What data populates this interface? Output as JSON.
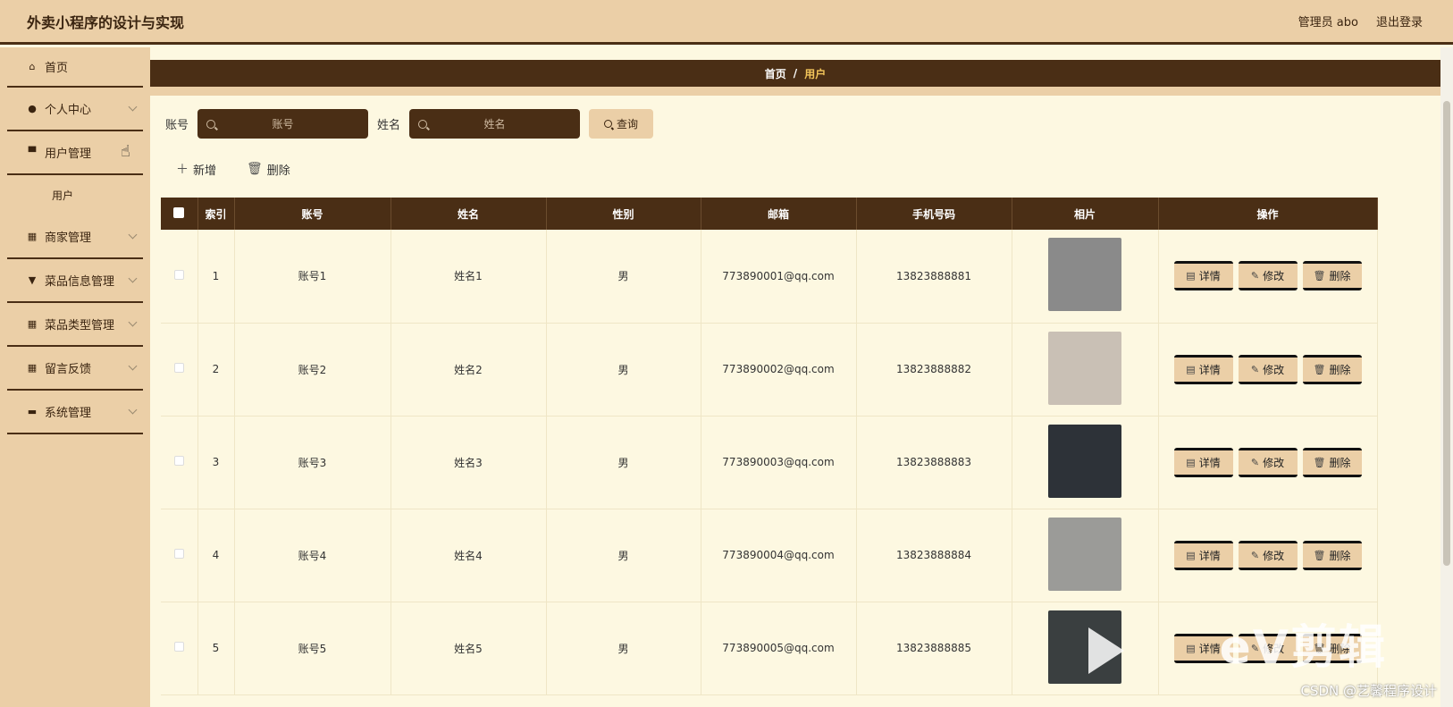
{
  "header": {
    "title": "外卖小程序的设计与实现",
    "user_label": "管理员 abo",
    "logout": "退出登录"
  },
  "sidebar": {
    "items": [
      {
        "label": "首页",
        "icon": "home-icon",
        "has_chevron": false
      },
      {
        "label": "个人中心",
        "icon": "user-icon",
        "has_chevron": true
      },
      {
        "label": "用户管理",
        "icon": "folder-icon",
        "has_chevron": true,
        "expanded": true
      },
      {
        "label": "用户",
        "sub": true
      },
      {
        "label": "商家管理",
        "icon": "grid-icon",
        "has_chevron": true
      },
      {
        "label": "菜品信息管理",
        "icon": "flag-icon",
        "has_chevron": true
      },
      {
        "label": "菜品类型管理",
        "icon": "grid-icon",
        "has_chevron": true
      },
      {
        "label": "留言反馈",
        "icon": "grid-icon",
        "has_chevron": true
      },
      {
        "label": "系统管理",
        "icon": "monitor-icon",
        "has_chevron": true
      }
    ]
  },
  "breadcrumb": {
    "home": "首页",
    "separator": "/",
    "current": "用户"
  },
  "search": {
    "account_label": "账号",
    "account_placeholder": "账号",
    "name_label": "姓名",
    "name_placeholder": "姓名",
    "query_button": "查询"
  },
  "toolbar": {
    "add": "新增",
    "delete": "删除"
  },
  "table": {
    "columns": [
      "索引",
      "账号",
      "姓名",
      "性别",
      "邮箱",
      "手机号码",
      "相片",
      "操作"
    ],
    "rows": [
      {
        "index": "1",
        "account": "账号1",
        "name": "姓名1",
        "gender": "男",
        "email": "773890001@qq.com",
        "phone": "13823888881",
        "photo_color": "#8a8a8a"
      },
      {
        "index": "2",
        "account": "账号2",
        "name": "姓名2",
        "gender": "男",
        "email": "773890002@qq.com",
        "phone": "13823888882",
        "photo_color": "#c9c0b5"
      },
      {
        "index": "3",
        "account": "账号3",
        "name": "姓名3",
        "gender": "男",
        "email": "773890003@qq.com",
        "phone": "13823888883",
        "photo_color": "#2d3238"
      },
      {
        "index": "4",
        "account": "账号4",
        "name": "姓名4",
        "gender": "男",
        "email": "773890004@qq.com",
        "phone": "13823888884",
        "photo_color": "#9b9b98"
      },
      {
        "index": "5",
        "account": "账号5",
        "name": "姓名5",
        "gender": "男",
        "email": "773890005@qq.com",
        "phone": "13823888885",
        "photo_color": "#3a3f40"
      }
    ],
    "op_detail": "详情",
    "op_edit": "修改",
    "op_delete": "删除"
  },
  "watermark": {
    "brand": "eV剪辑",
    "credit": "CSDN @艺馨程序设计"
  },
  "colors": {
    "accent_dark": "#4a2e15",
    "accent_light": "#ebcfa7",
    "background": "#fdf8e1",
    "breadcrumb_current": "#f2c55a"
  }
}
